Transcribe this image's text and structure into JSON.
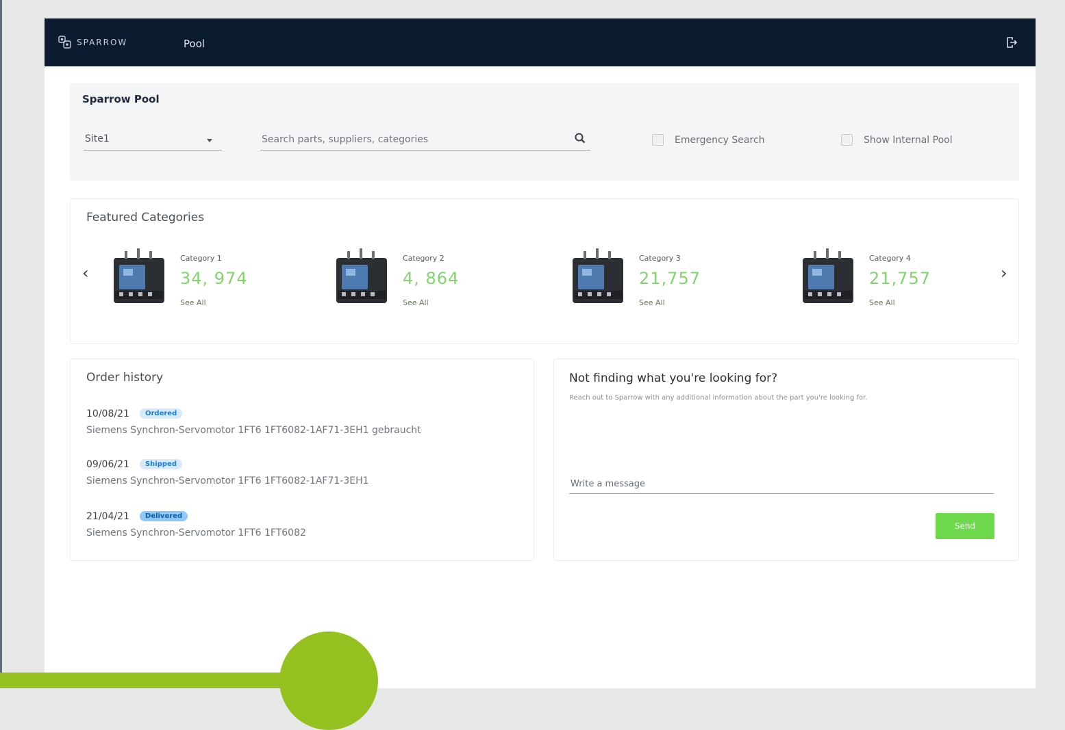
{
  "navbar": {
    "brand": "SPARROW",
    "title": "Pool"
  },
  "search_panel": {
    "title": "Sparrow Pool",
    "site_select_value": "Site1",
    "search_placeholder": "Search parts, suppliers, categories",
    "emergency_label": "Emergency Search",
    "internal_pool_label": "Show Internal Pool"
  },
  "featured": {
    "title": "Featured Categories",
    "categories": [
      {
        "name": "Category 1",
        "count": "34, 974",
        "link": "See All"
      },
      {
        "name": "Category 2",
        "count": "4, 864",
        "link": "See All"
      },
      {
        "name": "Category 3",
        "count": "21,757",
        "link": "See All"
      },
      {
        "name": "Category 4",
        "count": "21,757",
        "link": "See All"
      }
    ]
  },
  "orders": {
    "title": "Order history",
    "items": [
      {
        "date": "10/08/21",
        "status": "Ordered",
        "description": "Siemens Synchron-Servomotor 1FT6 1FT6082-1AF71-3EH1 gebraucht"
      },
      {
        "date": "09/06/21",
        "status": "Shipped",
        "description": "Siemens Synchron-Servomotor 1FT6 1FT6082-1AF71-3EH1"
      },
      {
        "date": "21/04/21",
        "status": "Delivered",
        "description": "Siemens Synchron-Servomotor 1FT6 1FT6082"
      }
    ]
  },
  "contact": {
    "title": "Not finding what you're looking for?",
    "subtitle": "Reach out to Sparrow with any additional information about the part you're looking for.",
    "message_placeholder": "Write a message",
    "send_label": "Send"
  },
  "colors": {
    "navbar": "#0b1b30",
    "accent_green": "#83d36e",
    "send_button": "#6fd94e",
    "badge_blue": "#1d7ed6"
  },
  "icons": {
    "logo": "sparrow-logo-icon",
    "logout": "logout-icon",
    "search": "search-icon",
    "prev": "chevron-left-icon",
    "next": "chevron-right-icon"
  }
}
